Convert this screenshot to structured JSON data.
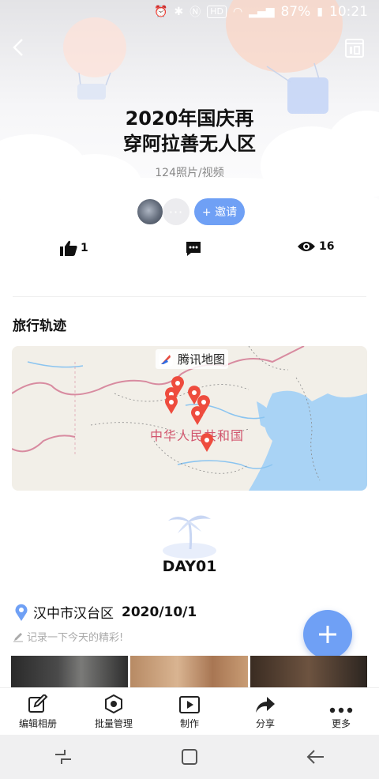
{
  "status_bar": {
    "battery": "87%",
    "time": "10:21",
    "hd": "HD"
  },
  "album": {
    "title_line1": "2020年国庆再",
    "title_line2": "穿阿拉善无人区",
    "media_count": "124照片/视频"
  },
  "members": {
    "invite_label": "+ 邀请",
    "more": "···"
  },
  "stats": {
    "likes": "1",
    "views": "16"
  },
  "track": {
    "title": "旅行轨迹",
    "map_brand": "腾讯地图",
    "map_country": "中华人民共和国"
  },
  "day": {
    "label": "DAY01",
    "location": "汉中市汉台区",
    "date": "2020/10/1",
    "note_placeholder": "记录一下今天的精彩!"
  },
  "toolbar": [
    {
      "label": "编辑相册",
      "icon": "edit-icon"
    },
    {
      "label": "批量管理",
      "icon": "batch-icon"
    },
    {
      "label": "制作",
      "icon": "play-icon"
    },
    {
      "label": "分享",
      "icon": "share-icon"
    },
    {
      "label": "更多",
      "icon": "more-icon"
    }
  ],
  "colors": {
    "accent": "#6fa0f5",
    "pin": "#ee4c3e",
    "map_border": "#d2566e"
  }
}
